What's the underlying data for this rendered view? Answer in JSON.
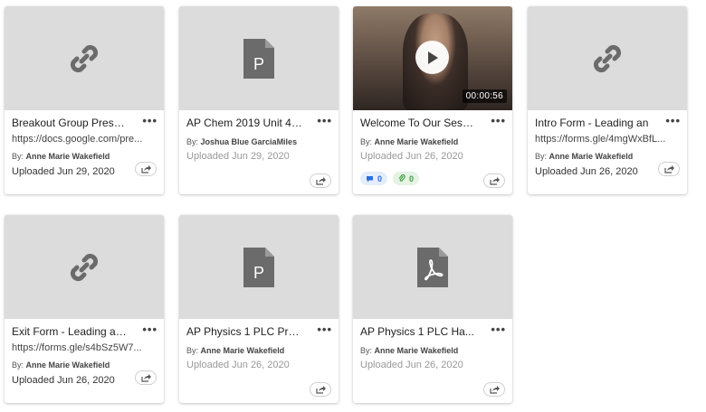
{
  "cards": [
    {
      "type": "link",
      "title": "Breakout Group Present",
      "url": "https://docs.google.com/pre...",
      "by_label": "By:",
      "author": "Anne Marie Wakefield",
      "uploaded": "Uploaded Jun 29, 2020"
    },
    {
      "type": "ppt",
      "title": "AP Chem 2019 Unit 4....",
      "by_label": "By:",
      "author": "Joshua Blue GarciaMiles",
      "uploaded": "Uploaded Jun 29, 2020",
      "file_letter": "P"
    },
    {
      "type": "video",
      "title": "Welcome To Our Sess...",
      "by_label": "By:",
      "author": "Anne Marie Wakefield",
      "uploaded": "Uploaded Jun 26, 2020",
      "duration": "00:00:56",
      "comment_count": "0",
      "attachment_count": "0"
    },
    {
      "type": "link",
      "title": "Intro Form - Leading an",
      "url": "https://forms.gle/4mgWxBfL...",
      "by_label": "By:",
      "author": "Anne Marie Wakefield",
      "uploaded": "Uploaded Jun 26, 2020"
    },
    {
      "type": "link",
      "title": "Exit Form - Leading an E",
      "url": "https://forms.gle/s4bSz5W7...",
      "by_label": "By:",
      "author": "Anne Marie Wakefield",
      "uploaded": "Uploaded Jun 26, 2020"
    },
    {
      "type": "ppt",
      "title": "AP Physics 1 PLC Pre...",
      "by_label": "By:",
      "author": "Anne Marie Wakefield",
      "uploaded": "Uploaded Jun 26, 2020",
      "file_letter": "P"
    },
    {
      "type": "pdf",
      "title": "AP Physics 1 PLC Ha...",
      "by_label": "By:",
      "author": "Anne Marie Wakefield",
      "uploaded": "Uploaded Jun 26, 2020"
    }
  ],
  "menu_glyph": "•••",
  "icons": {
    "link": "link-icon",
    "ppt": "powerpoint-file-icon",
    "pdf": "pdf-file-icon",
    "play": "play-icon",
    "share": "share-icon",
    "comment": "comment-icon",
    "attachment": "paperclip-icon"
  },
  "colors": {
    "thumb_bg": "#dcdcdc",
    "icon_gray": "#6b6b6b",
    "comment_blue": "#2b6fd6",
    "attach_green": "#3f9a3f"
  }
}
